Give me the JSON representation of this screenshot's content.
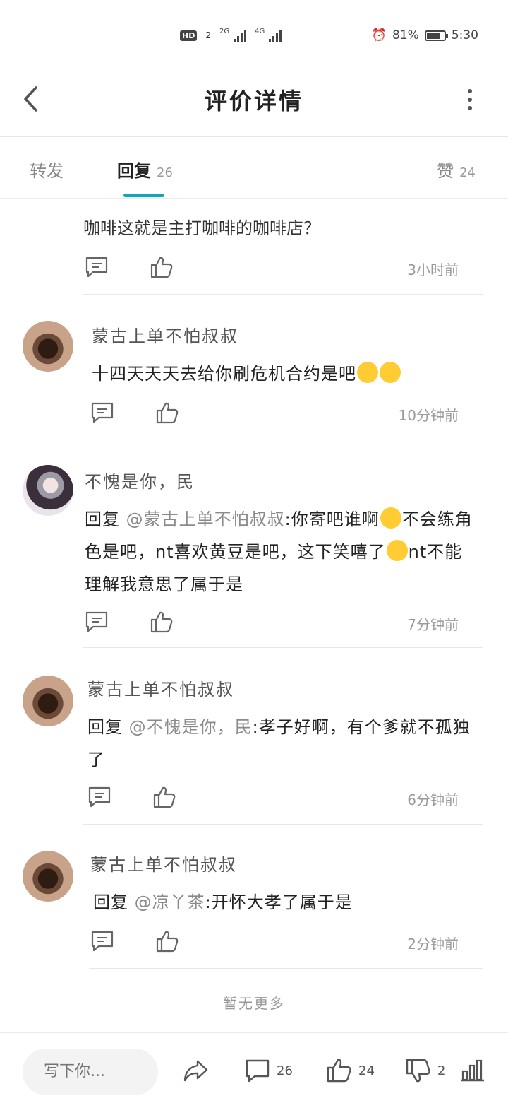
{
  "status_bar": {
    "hd": "HD",
    "sim": "2",
    "net1": "2G",
    "net2": "4G",
    "battery_pct": "81%",
    "battery_level": 0.81,
    "time": "5:30"
  },
  "header": {
    "title": "评价详情"
  },
  "tabs": {
    "forward": "转发",
    "reply": "回复",
    "reply_count": "26",
    "like": "赞",
    "like_count": "24"
  },
  "comments": [
    {
      "text": "咖啡这就是主打咖啡的咖啡店？",
      "time": "3小时前"
    },
    {
      "name": "蒙古上单不怕叔叔",
      "text": "十四天天天去给你刷危机合约是吧",
      "time": "10分钟前"
    },
    {
      "name": "不愧是你，民",
      "prefix": "回复",
      "mention": "@蒙古上单不怕叔叔",
      "text": ":你寄吧谁啊",
      "text2": "不会练角色是吧，nt喜欢黄豆是吧，这下笑嘻了",
      "text3": "nt不能理解我意思了属于是",
      "time": "7分钟前"
    },
    {
      "name": "蒙古上单不怕叔叔",
      "prefix": "回复",
      "mention": "@不愧是你，民",
      "text": ":孝子好啊，有个爹就不孤独了",
      "time": "6分钟前"
    },
    {
      "name": "蒙古上单不怕叔叔",
      "prefix": "回复",
      "mention": "@凉丫茶",
      "text": ":开怀大孝了属于是",
      "time": "2分钟前"
    }
  ],
  "no_more": "暂无更多",
  "bottom_bar": {
    "input_placeholder": "写下你...",
    "comment_count": "26",
    "like_count": "24",
    "dislike_count": "2"
  }
}
